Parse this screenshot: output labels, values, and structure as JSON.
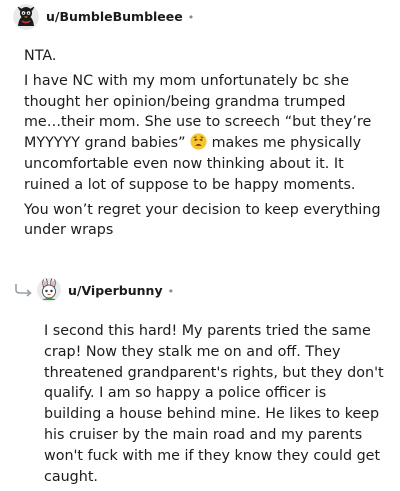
{
  "comments": [
    {
      "username": "u/BumbleBumbleee",
      "separator": "•",
      "avatar": "cartoon-character-avatar",
      "paragraphs": [
        "NTA.",
        "I have NC with my mom unfortunately bc she thought her opinion/being grandma trumped me…their mom. She use to screech “but they’re MYYYYY grand babies”",
        " makes me physically uncomfortable even now thinking about it. It ruined a lot of suppose to be happy moments.",
        "You won’t regret your decision to keep everything under wraps"
      ],
      "emoji": "tired-face-emoji"
    },
    {
      "username": "u/Viperbunny",
      "separator": "•",
      "avatar": "bunny-character-avatar",
      "reply_icon": "reply-arrow-icon",
      "paragraphs": [
        "I second this hard! My parents tried the same crap! Now they stalk me on and off. They threatened grandparent's rights, but they don't qualify. I am so happy a police officer is building a house behind mine. He likes to keep his cruiser by the main road and my parents won't fuck with me if they know they could get caught."
      ]
    }
  ]
}
